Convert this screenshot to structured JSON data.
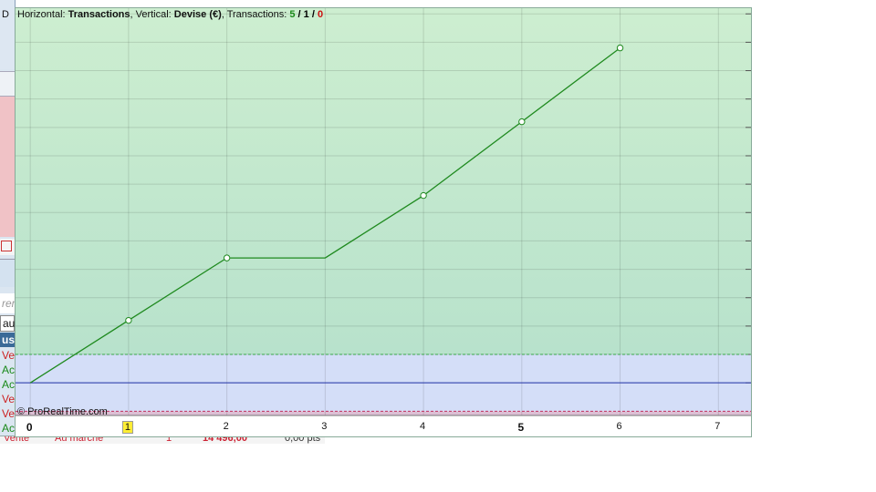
{
  "legend": {
    "horizontal_prefix": "Horizontal: ",
    "horizontal_value": "Transactions",
    "vertical_prefix": ", Vertical: ",
    "vertical_value": "Devise (€)",
    "transactions_prefix": ", Transactions: ",
    "tx_win": "5",
    "sep1": " / ",
    "tx_neutral": "1",
    "sep2": " / ",
    "tx_loss": "0"
  },
  "copyright": "© ProRealTime.com",
  "left_panel": {
    "fragments": [
      "D",
      "rer",
      "au",
      "us",
      "Ve",
      "Ac",
      "Ac",
      "Ve",
      "Ve",
      "Ac"
    ]
  },
  "bottom_row": [
    "Vente",
    "Au marché",
    "1",
    "14 496,00",
    "0,00 pts"
  ],
  "colors": {
    "profit_zone_top": "#cdeed0",
    "profit_zone_bottom": "#b8e2cc",
    "neutral_zone": "#d4def8",
    "loss_zone": "#dcbfd4",
    "curve": "#1f8a1f",
    "baseline": "#2233aa"
  },
  "chart_data": {
    "type": "line",
    "x_ticks": [
      "0",
      "1",
      "2",
      "3",
      "4",
      "5",
      "6",
      "7"
    ],
    "highlighted_tick": "1",
    "bold_ticks": [
      "0",
      "5"
    ],
    "x": [
      0,
      1,
      2,
      3,
      4,
      5,
      6
    ],
    "y": [
      0,
      2.2,
      4.4,
      4.4,
      6.6,
      9.2,
      11.8
    ],
    "marker_points": [
      1,
      2,
      4,
      5,
      6
    ],
    "xlim": [
      -0.15,
      7.35
    ],
    "ylim": [
      -1.15,
      13.2
    ],
    "grid": true
  }
}
